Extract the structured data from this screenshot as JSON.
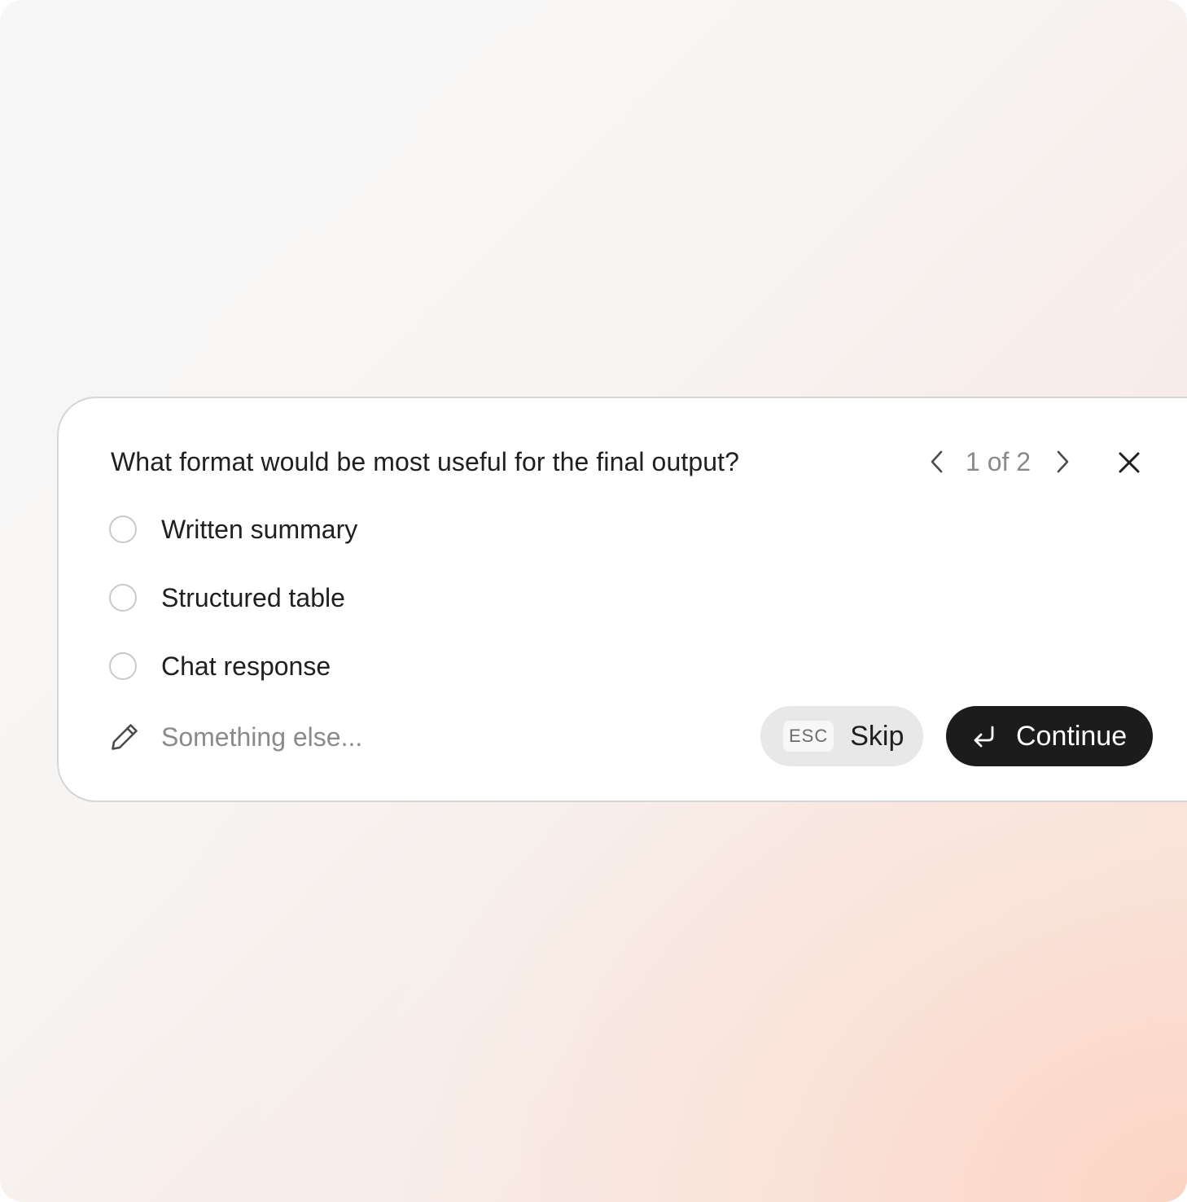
{
  "dialog": {
    "question": "What format would be most useful for the final output?",
    "pager": {
      "current": "1",
      "total": "2",
      "text": "1 of 2",
      "prev_icon": "chevron-left-icon",
      "next_icon": "chevron-right-icon"
    },
    "close_icon": "close-icon",
    "options": [
      {
        "label": "Written summary",
        "selected": false
      },
      {
        "label": "Structured table",
        "selected": false
      },
      {
        "label": "Chat response",
        "selected": false
      }
    ],
    "other": {
      "icon": "pencil-icon",
      "placeholder": "Something else...",
      "value": ""
    },
    "skip": {
      "shortcut": "ESC",
      "label": "Skip"
    },
    "continue": {
      "icon": "enter-icon",
      "label": "Continue"
    }
  },
  "colors": {
    "card_background": "#ffffff",
    "card_border": "#d6d6d6",
    "primary_button": "#1c1c1c",
    "secondary_button": "#e8e8e8",
    "muted_text": "#8a8a8a",
    "background_accent": "#fbd6c8"
  }
}
